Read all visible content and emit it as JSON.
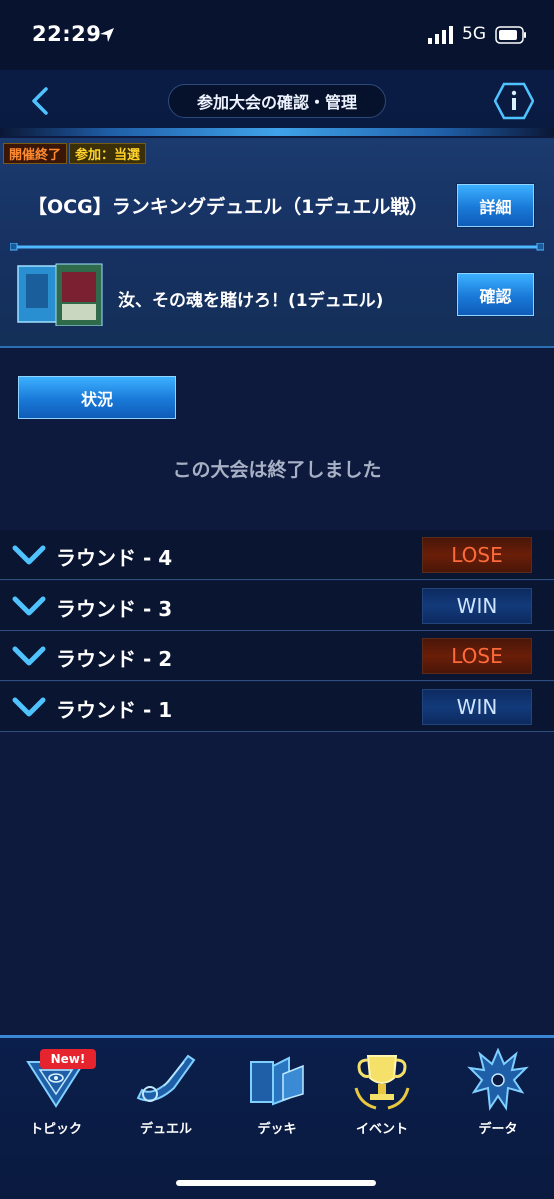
{
  "status_bar": {
    "time": "22:29",
    "network": "5G"
  },
  "header": {
    "title": "参加大会の確認・管理"
  },
  "event": {
    "badges": [
      "開催終了",
      "参加：当選"
    ],
    "title": "【OCG】ランキングデュエル（1デュエル戦）",
    "detail_label": "詳細",
    "deck_name": "汝、その魂を賭けろ！(1デュエル)",
    "confirm_label": "確認"
  },
  "status_tab_label": "状況",
  "ended_message": "この大会は終了しました",
  "rounds": [
    {
      "label": "ラウンド - 4",
      "result": "LOSE"
    },
    {
      "label": "ラウンド - 3",
      "result": "WIN"
    },
    {
      "label": "ラウンド - 2",
      "result": "LOSE"
    },
    {
      "label": "ラウンド - 1",
      "result": "WIN"
    }
  ],
  "tabbar": {
    "new_badge": "New!",
    "items": [
      "トピック",
      "デュエル",
      "デッキ",
      "イベント",
      "データ"
    ]
  },
  "colors": {
    "accent_blue": "#1a79d8",
    "lose_text": "#ff6a3a",
    "win_text": "#cfe4ff",
    "badge_ended": "#ff8a30",
    "badge_status": "#ffd32a"
  }
}
